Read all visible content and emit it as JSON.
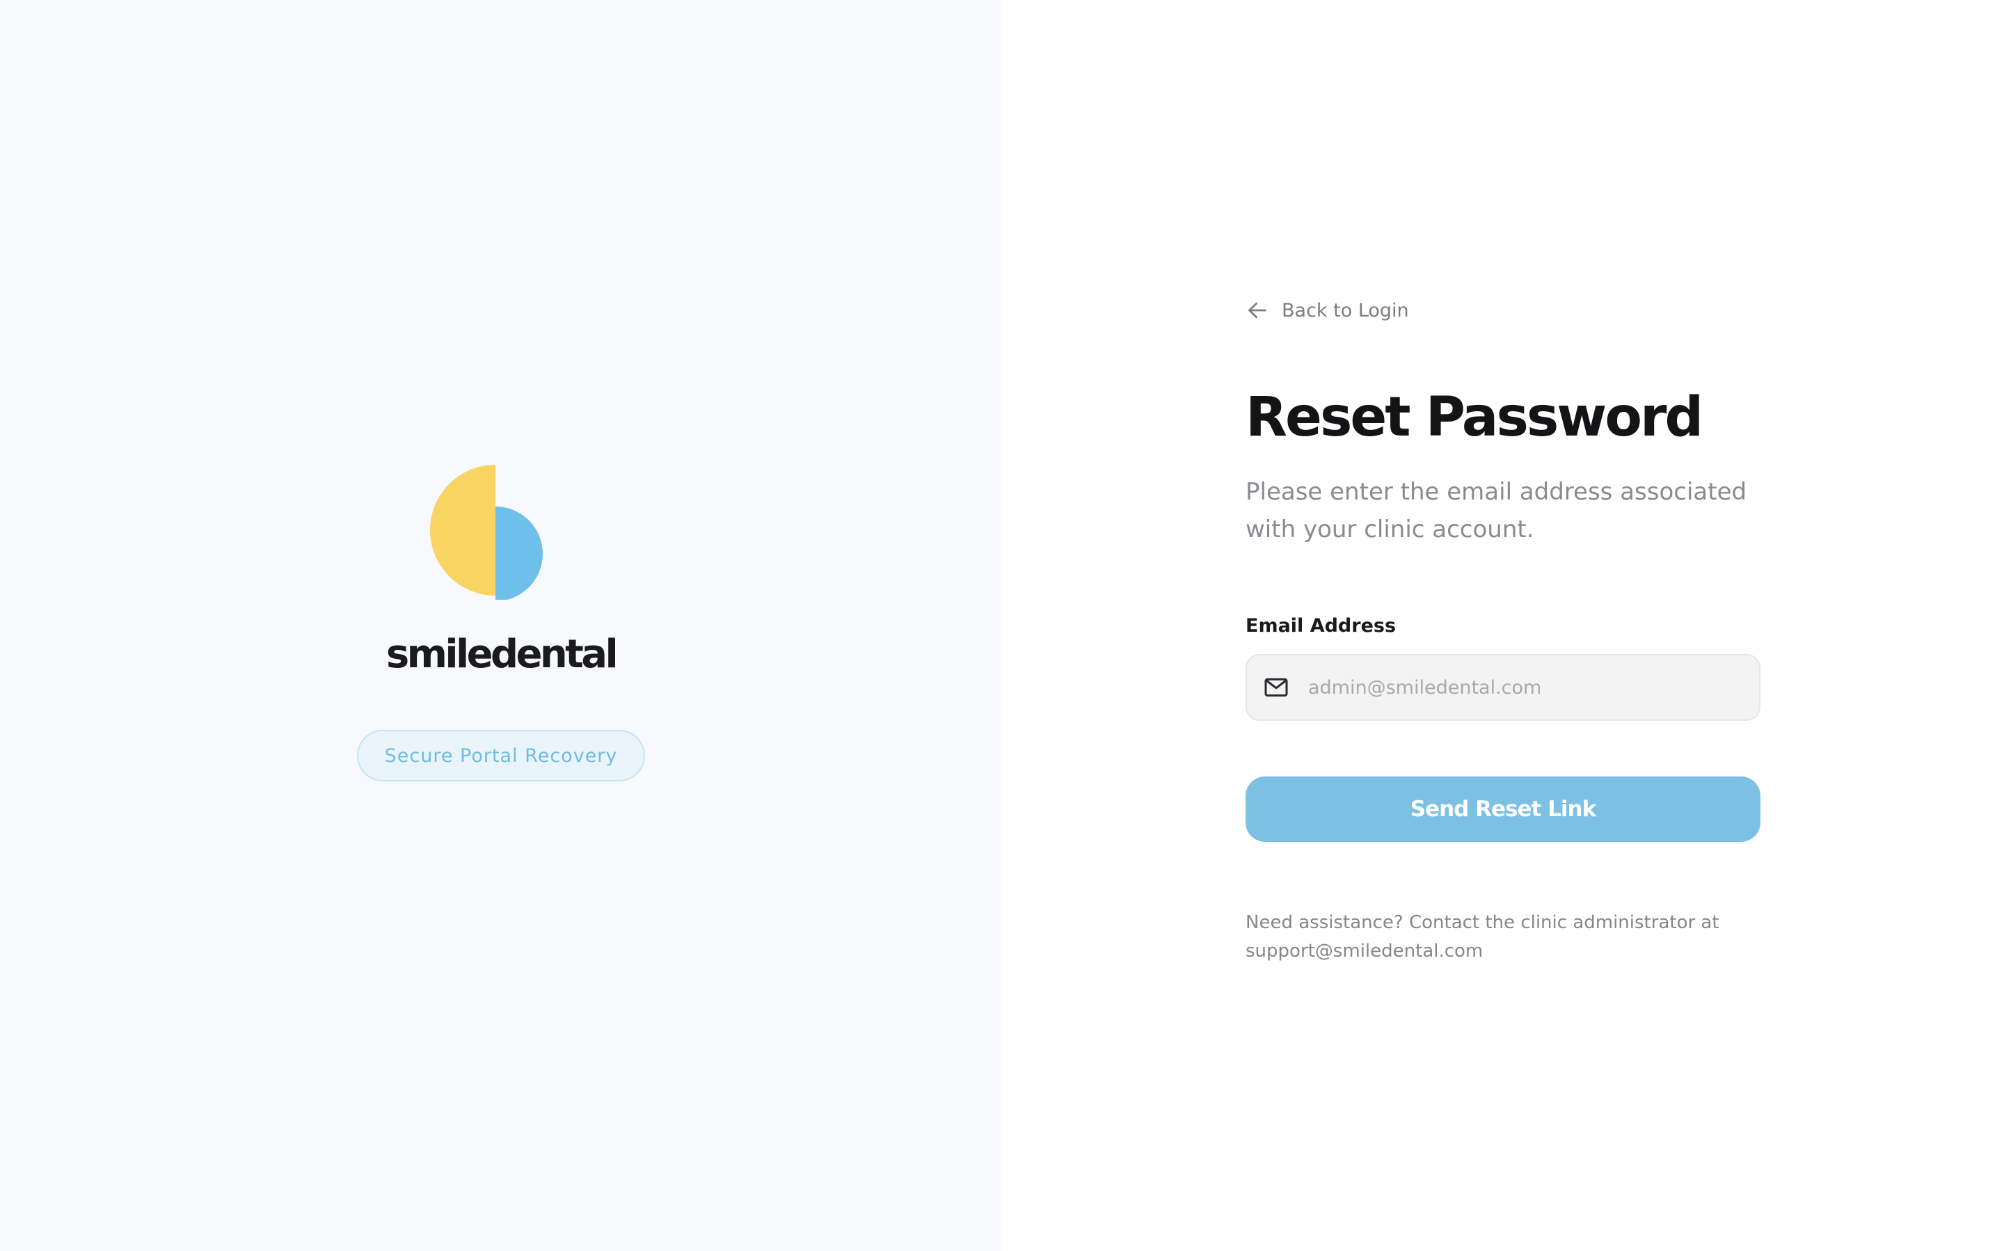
{
  "brand": {
    "name": "smiledental",
    "badge": "Secure Portal Recovery",
    "colors": {
      "logo_yellow": "#f8d462",
      "logo_blue": "#6ec0ea",
      "panel_bg": "#f7f9fc",
      "pill_text": "#6fbce3"
    }
  },
  "form": {
    "back_link": {
      "label": "Back to Login",
      "icon": "arrow-left-icon"
    },
    "title": "Reset Password",
    "subtitle": "Please enter the email address associated with your clinic account.",
    "email": {
      "label": "Email Address",
      "placeholder": "admin@smiledental.com",
      "value": "",
      "icon": "mail-icon"
    },
    "submit_label": "Send Reset Link",
    "help_text": "Need assistance? Contact the clinic administrator at support@smiledental.com",
    "colors": {
      "primary": "#7cc0e4",
      "title": "#141416",
      "muted": "#8a8a8f"
    }
  }
}
